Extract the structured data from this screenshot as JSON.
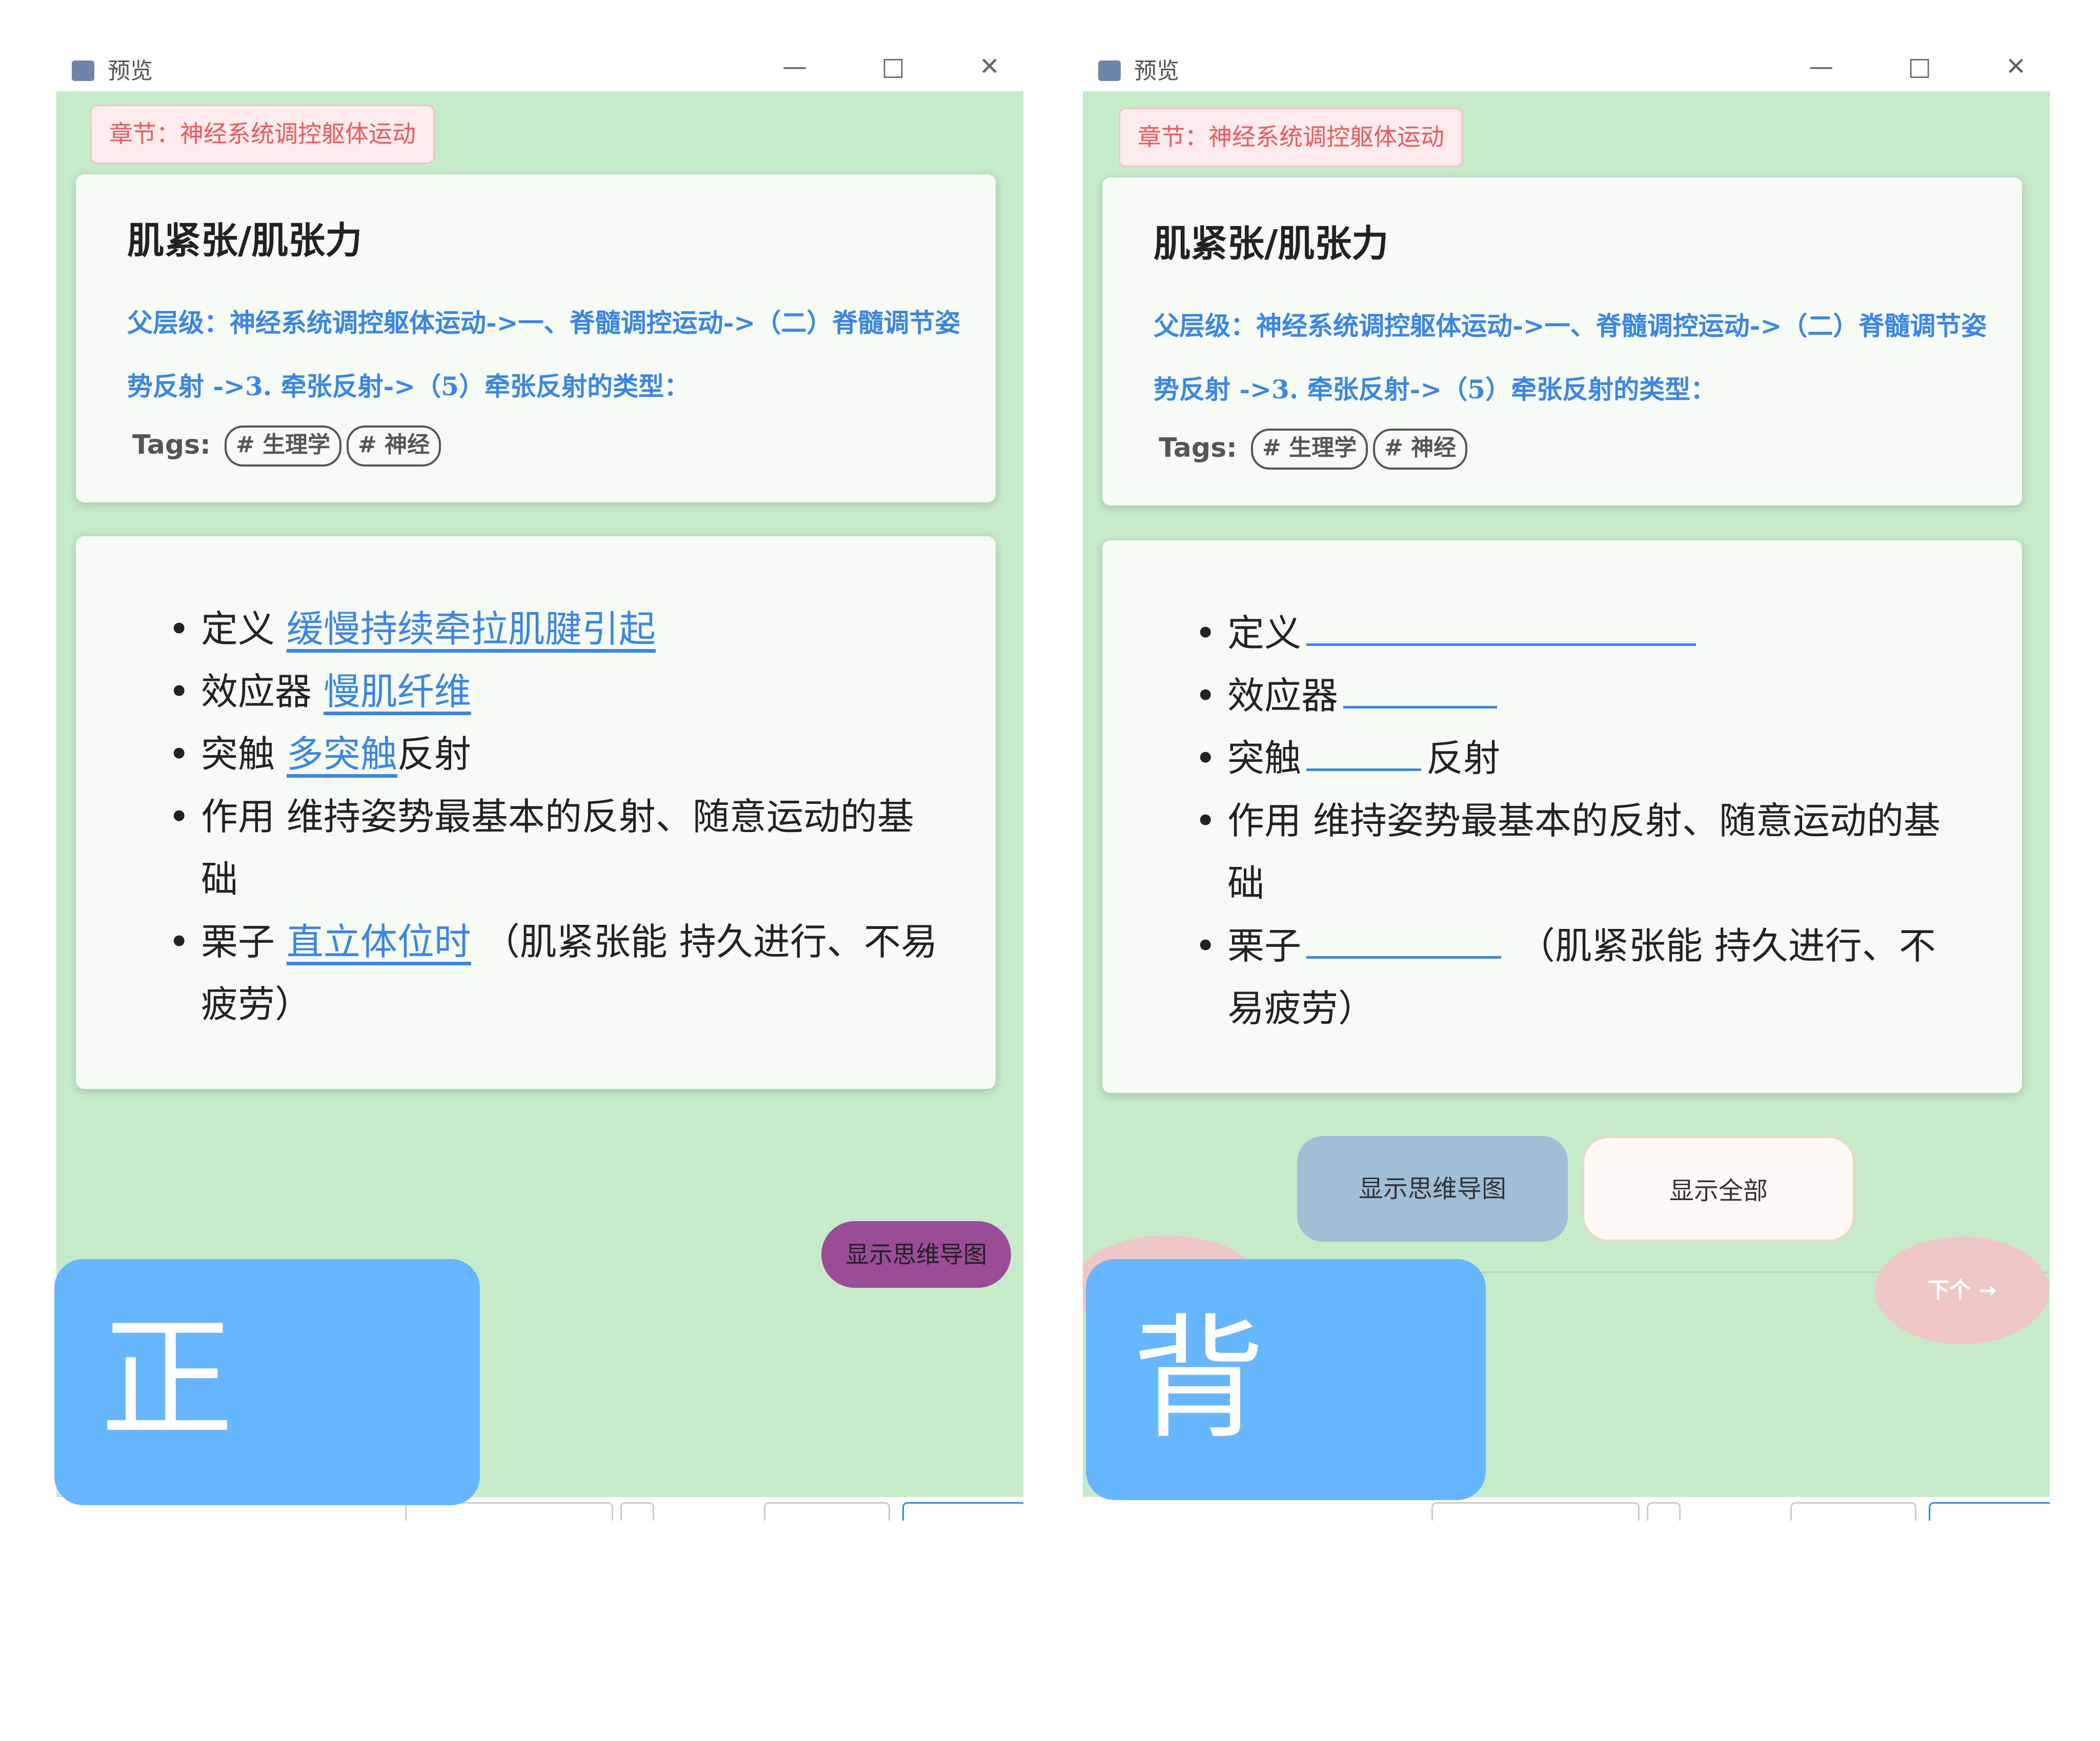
{
  "window": {
    "title": "预览"
  },
  "chapter": "章节：神经系统调控躯体运动",
  "card": {
    "title": "肌紧张/肌张力",
    "parent_prefix": "父层级：",
    "parent_path": "神经系统调控躯体运动->一、脊髓调控运动->（二）脊髓调节姿势反射 ->3. 牵张反射->（5）牵张反射的类型：",
    "tags_label": "Tags:",
    "tags": [
      "# 生理学",
      "# 神经"
    ]
  },
  "content": {
    "items": [
      {
        "label": "定义",
        "answer": "缓慢持续牵拉肌腱引起",
        "suffix": ""
      },
      {
        "label": "效应器",
        "answer": "慢肌纤维",
        "suffix": ""
      },
      {
        "label": "突触",
        "answer": "多突触",
        "suffix": "反射"
      },
      {
        "label": "作用",
        "answer": "",
        "suffix": "维持姿势最基本的反射、随意运动的基础"
      },
      {
        "label": "栗子",
        "answer": "直立体位时",
        "suffix": "（肌紧张能 持久进行、不易疲劳）"
      }
    ]
  },
  "front": {
    "mind_button": "显示思维导图",
    "overlay_label": "正面："
  },
  "back": {
    "mind_button": "显示思维导图",
    "show_all_button": "显示全部",
    "next_label": "下个",
    "overlay_label": "背面："
  },
  "colors": {
    "accent_blue": "#3a86e8",
    "pane_green": "#c6ebc9",
    "overlay_blue": "#66b7ff",
    "chapter_red": "#f05a5a",
    "purple": "#9a4d96"
  }
}
